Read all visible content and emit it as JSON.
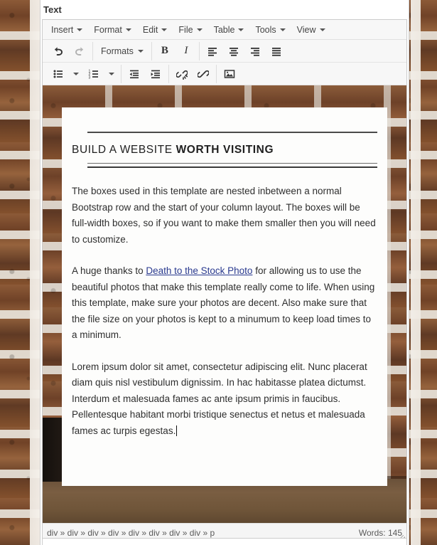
{
  "window": {
    "panel_title": "Text"
  },
  "menubar": {
    "items": [
      {
        "label": "Insert",
        "icon": "chevron-down-icon"
      },
      {
        "label": "Format",
        "icon": "chevron-down-icon"
      },
      {
        "label": "Edit",
        "icon": "chevron-down-icon"
      },
      {
        "label": "File",
        "icon": "chevron-down-icon"
      },
      {
        "label": "Table",
        "icon": "chevron-down-icon"
      },
      {
        "label": "Tools",
        "icon": "chevron-down-icon"
      },
      {
        "label": "View",
        "icon": "chevron-down-icon"
      }
    ]
  },
  "toolbar_row1": {
    "undo": {
      "icon": "undo-icon",
      "title": "Undo",
      "enabled": true
    },
    "redo": {
      "icon": "redo-icon",
      "title": "Redo",
      "enabled": false
    },
    "formats": {
      "label": "Formats",
      "icon": "chevron-down-icon"
    },
    "bold": {
      "icon": "bold-icon",
      "glyph": "B",
      "title": "Bold"
    },
    "italic": {
      "icon": "italic-icon",
      "glyph": "I",
      "title": "Italic"
    },
    "align_left": {
      "icon": "align-left-icon",
      "title": "Align left"
    },
    "align_center": {
      "icon": "align-center-icon",
      "title": "Align center"
    },
    "align_right": {
      "icon": "align-right-icon",
      "title": "Align right"
    },
    "align_justify": {
      "icon": "align-justify-icon",
      "title": "Justify"
    }
  },
  "toolbar_row2": {
    "bullist": {
      "icon": "bullet-list-icon",
      "title": "Bullet list"
    },
    "bullist_split": {
      "icon": "chevron-down-icon"
    },
    "numlist": {
      "icon": "numbered-list-icon",
      "title": "Numbered list"
    },
    "numlist_split": {
      "icon": "chevron-down-icon"
    },
    "outdent": {
      "icon": "outdent-icon",
      "title": "Decrease indent"
    },
    "indent": {
      "icon": "indent-icon",
      "title": "Increase indent"
    },
    "unlink": {
      "icon": "unlink-icon",
      "title": "Remove link"
    },
    "link": {
      "icon": "link-icon",
      "title": "Insert/edit link"
    },
    "image": {
      "icon": "image-icon",
      "title": "Insert/edit image"
    }
  },
  "document": {
    "heading_normal": "BUILD A WEBSITE ",
    "heading_bold": "WORTH VISITING",
    "paragraph1": "The boxes used in this template are nested inbetween a normal Bootstrap row and the start of your column layout. The boxes will be full-width boxes, so if you want to make them smaller then you will need to customize.",
    "paragraph2_before": "A huge thanks to ",
    "paragraph2_link": "Death to the Stock Photo",
    "paragraph2_after": " for allowing us to use the beautiful photos that make this template really come to life. When using this template, make sure your photos are decent. Also make sure that the file size on your photos is kept to a minumum to keep load times to a minimum.",
    "paragraph3": "Lorem ipsum dolor sit amet, consectetur adipiscing elit. Nunc placerat diam quis nisl vestibulum dignissim. In hac habitasse platea dictumst. Interdum et malesuada fames ac ante ipsum primis in faucibus. Pellentesque habitant morbi tristique senectus et netus et malesuada fames ac turpis egestas."
  },
  "statusbar": {
    "element_path": "div » div » div » div » div » div » div » div » p",
    "word_count": "Words: 145",
    "resize_handle": "resize-grip-icon"
  },
  "colors": {
    "link": "#2a3a8f",
    "chrome_bg": "#f7f7f7",
    "border": "#cccccc",
    "text": "#2e2e2e",
    "brick_dark": "#6d4128",
    "brick_light": "#955f3c",
    "mortar": "#e6e1d9"
  }
}
